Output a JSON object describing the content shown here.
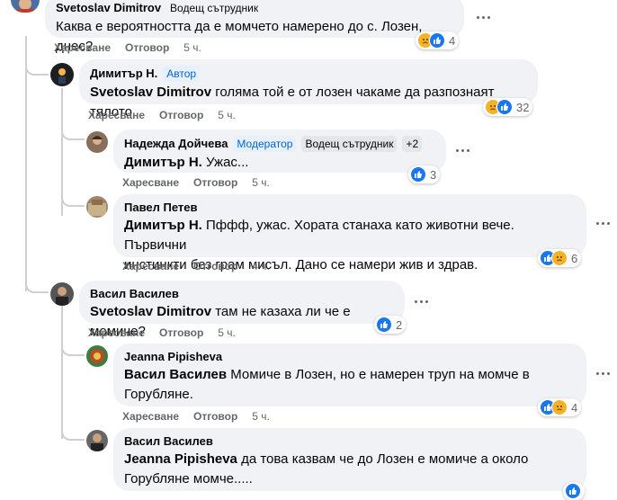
{
  "labels": {
    "like": "Харесване",
    "reply": "Отговор"
  },
  "comments": [
    {
      "author": "Svetoslav Dimitrov",
      "badges": [
        "Водещ сътрудник"
      ],
      "mention": "",
      "text": "Каква е вероятността да е момчето намерено до с. Лозен, днес?",
      "time": "5 ч.",
      "reactions": [
        "sad",
        "like"
      ],
      "react_count": "4"
    },
    {
      "author": "Димитър Н.",
      "badges": [
        "Автор"
      ],
      "mention": "Svetoslav Dimitrov",
      "text": " голяма той е от лозен чакаме да разпознаят тялото",
      "time": "5 ч.",
      "reactions": [
        "sad",
        "like"
      ],
      "react_count": "32"
    },
    {
      "author": "Надежда Дойчева",
      "badges": [
        "Модератор",
        "Водещ сътрудник",
        "+2"
      ],
      "mention": "Димитър Н.",
      "text": " Ужас...",
      "time": "5 ч.",
      "reactions": [
        "like"
      ],
      "react_count": "3"
    },
    {
      "author": "Павел Петев",
      "badges": [],
      "mention": "Димитър Н.",
      "text_line1": " Пффф, ужас. Хората станаха като животни вече. Първични",
      "text_line2": "инстинкти без грам мисъл. Дано се намери жив и здрав.",
      "time": "4 ч.",
      "reactions": [
        "like",
        "sad"
      ],
      "react_count": "6"
    },
    {
      "author": "Васил Василев",
      "badges": [],
      "mention": "Svetoslav Dimitrov",
      "text": " там не казаха ли че е момиче?",
      "time": "5 ч.",
      "reactions": [
        "like"
      ],
      "react_count": "2"
    },
    {
      "author": "Jeanna Pipisheva",
      "badges": [],
      "mention": "Васил Василев",
      "text_line1": " Момиче в Лозен, но е намерен труп на момче в",
      "text_line2": "Горубляне.",
      "time": "5 ч.",
      "reactions": [
        "like",
        "sad"
      ],
      "react_count": "4"
    },
    {
      "author": "Васил Василев",
      "badges": [],
      "mention": "Jeanna Pipisheva",
      "text_line1": " да това казвам че до Лозен е момиче а около",
      "text_line2": "Горубляне момче.....",
      "reactions": [
        "like"
      ]
    }
  ],
  "colors": {
    "bubble": "#f0f2f5",
    "like": "#1877f2",
    "sad": "#f7b125",
    "meta": "#65676b",
    "badge_blue": "#0064d1"
  }
}
